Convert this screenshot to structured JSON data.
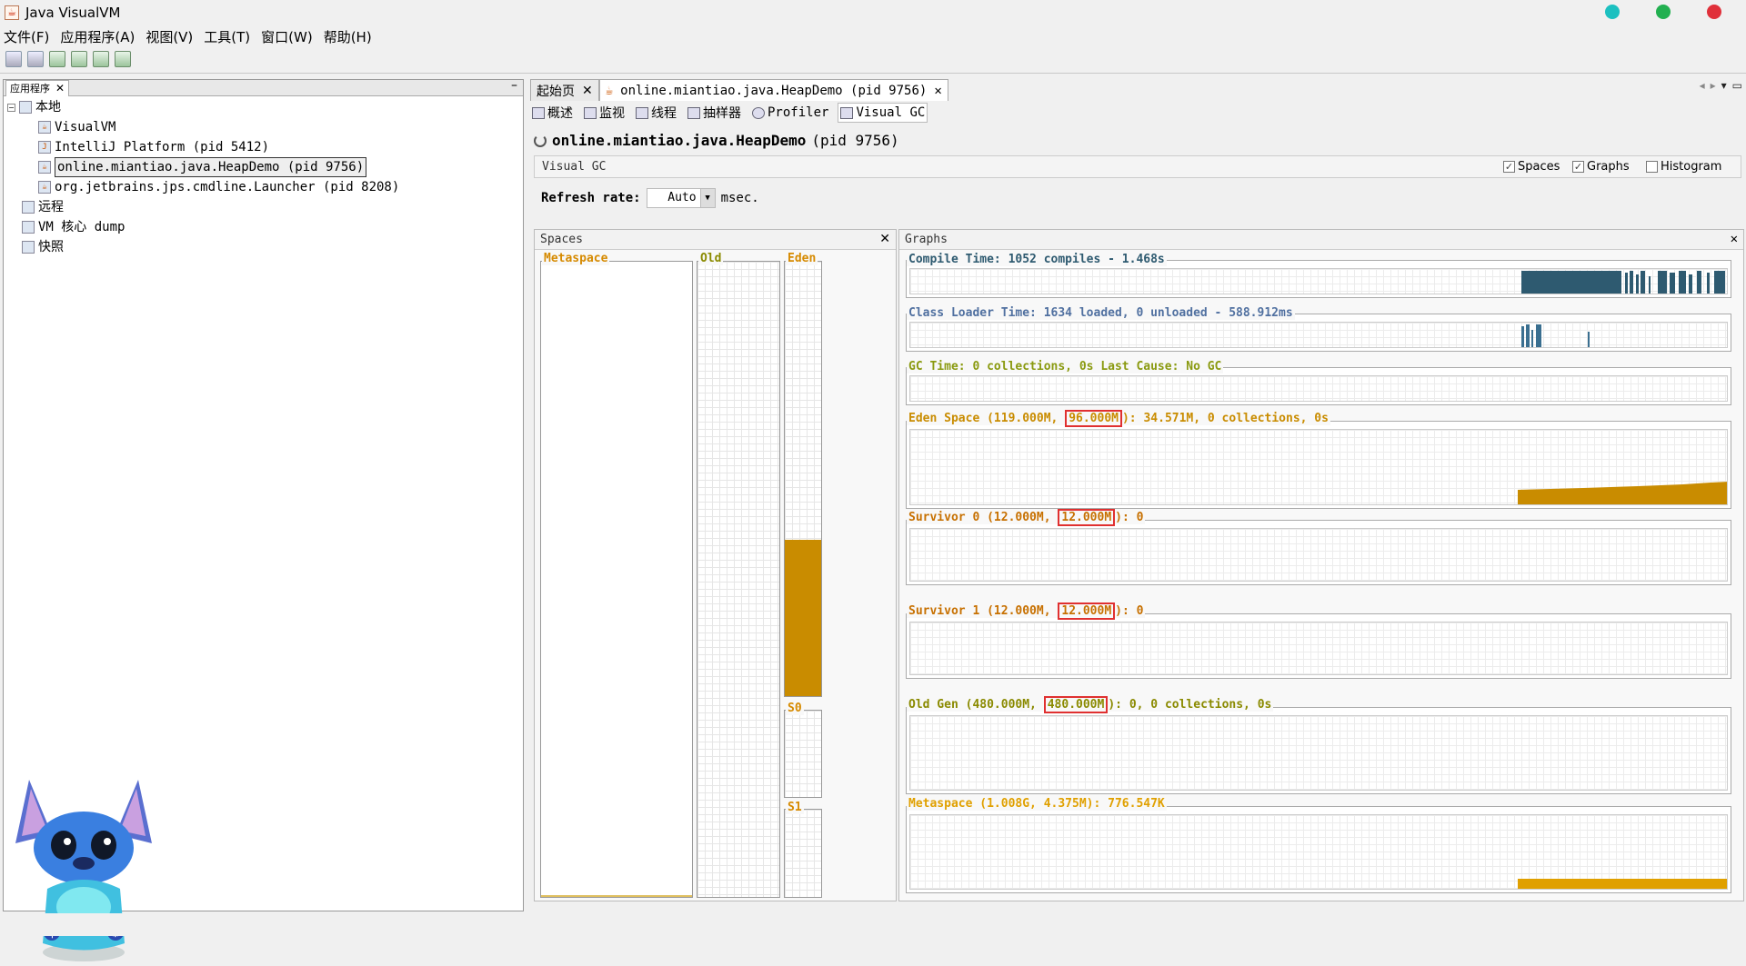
{
  "window": {
    "title": "Java VisualVM",
    "app_icon": "java-cup-icon",
    "controls": [
      "#1cc0c0",
      "#22b050",
      "#e0303a"
    ]
  },
  "menu": [
    "文件(F)",
    "应用程序(A)",
    "视图(V)",
    "工具(T)",
    "窗口(W)",
    "帮助(H)"
  ],
  "left": {
    "tab_label": "应用程序",
    "tree": {
      "local": "本地",
      "visualvm": "VisualVM",
      "intellij": "IntelliJ Platform (pid 5412)",
      "heapdemo": "online.miantiao.java.HeapDemo (pid 9756)",
      "launcher": "org.jetbrains.jps.cmdline.Launcher (pid 8208)",
      "remote": "远程",
      "coredump": "VM 核心 dump",
      "snapshot": "快照"
    },
    "mascot": {
      "chars": [
        "中",
        "☽",
        "°",
        "⚙"
      ]
    }
  },
  "tabs": {
    "start": "起始页",
    "heapdemo": "online.miantiao.java.HeapDemo (pid 9756)"
  },
  "subtabs": [
    "概述",
    "监视",
    "线程",
    "抽样器",
    "Profiler",
    "Visual GC"
  ],
  "pid_title": {
    "name": "online.miantiao.java.HeapDemo",
    "pid": "(pid 9756)"
  },
  "visual_gc": {
    "label": "Visual GC",
    "spaces_cb": "Spaces",
    "graphs_cb": "Graphs",
    "histogram_cb": "Histogram",
    "spaces_checked": true,
    "graphs_checked": true,
    "histogram_checked": false,
    "refresh_label": "Refresh rate:",
    "refresh_value": "Auto",
    "refresh_unit": "msec."
  },
  "spaces": {
    "title": "Spaces",
    "metaspace": "Metaspace",
    "old": "Old",
    "eden": "Eden",
    "s0": "S0",
    "s1": "S1",
    "eden_fill": 0.36,
    "old_fill": 0.0,
    "metaspace_fill": 0.0
  },
  "graphs": {
    "title": "Graphs",
    "compile": "Compile Time: 1052 compiles - 1.468s",
    "classloader": "Class Loader Time: 1634 loaded, 0 unloaded - 588.912ms",
    "gctime": "GC Time: 0 collections, 0s Last Cause: No GC",
    "eden_pre": "Eden Space (119.000M, ",
    "eden_hl": "96.000M",
    "eden_post": "): 34.571M, 0 collections, 0s",
    "s0_pre": "Survivor 0 (12.000M, ",
    "s0_hl": "12.000M",
    "s0_post": "): 0",
    "s1_pre": "Survivor 1 (12.000M, ",
    "s1_hl": "12.000M",
    "s1_post": "): 0",
    "old_pre": "Old Gen (480.000M, ",
    "old_hl": "480.000M",
    "old_post": "): 0, 0 collections, 0s",
    "meta": "Metaspace (1.008G, 4.375M): 776.547K"
  }
}
